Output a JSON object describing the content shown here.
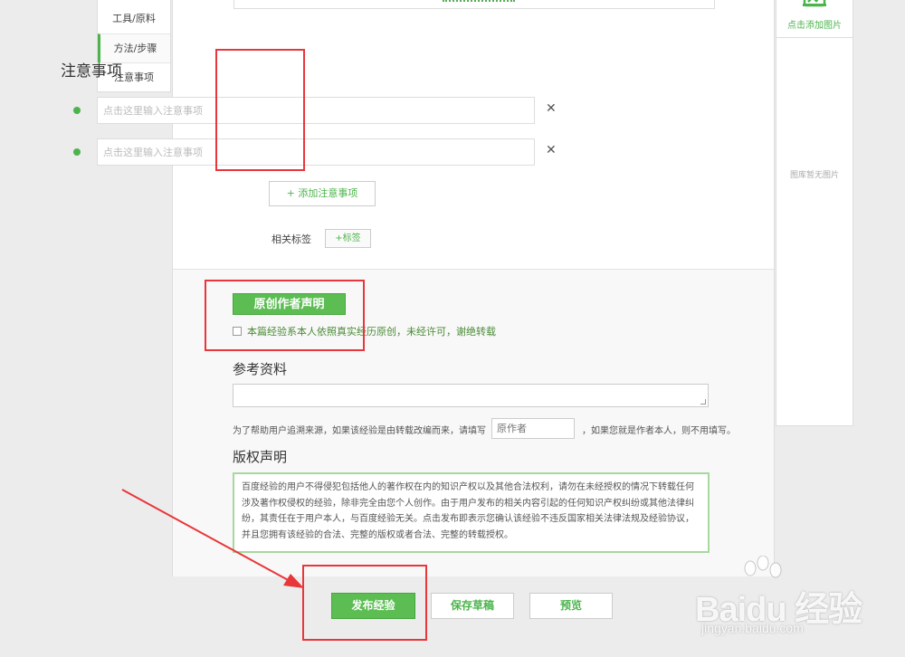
{
  "leftnav": {
    "items": [
      {
        "label": "工具/原料",
        "active": false
      },
      {
        "label": "方法/步骤",
        "active": true
      },
      {
        "label": "注意事项",
        "active": false
      }
    ]
  },
  "notes": {
    "title": "注意事项",
    "placeholder": "点击这里输入注意事项",
    "add_label": "+ 添加注意事项"
  },
  "tags": {
    "label": "相关标签",
    "add_label": "+标签"
  },
  "original": {
    "badge": "原创作者声明",
    "checkbox_label": "本篇经验系本人依照真实经历原创，未经许可，谢绝转载",
    "checked": false
  },
  "reference": {
    "title": "参考资料",
    "help_prefix": "为了帮助用户追溯来源，如果该经验是由转载改编而来，请填写",
    "author_placeholder": "原作者",
    "help_suffix": "，如果您就是作者本人，则不用填写。"
  },
  "copyright": {
    "title": "版权声明",
    "text": "百度经验的用户不得侵犯包括他人的著作权在内的知识产权以及其他合法权利，请勿在未经授权的情况下转载任何涉及著作权侵权的经验，除非完全由您个人创作。由于用户发布的相关内容引起的任何知识产权纠纷或其他法律纠纷，其责任在于用户本人，与百度经验无关。点击发布即表示您确认该经验不违反国家相关法律法规及经验协议，并且您拥有该经验的合法、完整的版权或者合法、完整的转载授权。"
  },
  "actions": {
    "publish": "发布经验",
    "draft": "保存草稿",
    "preview": "预览"
  },
  "image_panel": {
    "add_label": "点击添加图片",
    "empty_label": "图库暂无图片"
  },
  "watermark": {
    "brand": "Baidu 经验",
    "url": "jingyan.baidu.com"
  },
  "colors": {
    "accent": "#4cb44c",
    "annotation": "#e8363a"
  }
}
